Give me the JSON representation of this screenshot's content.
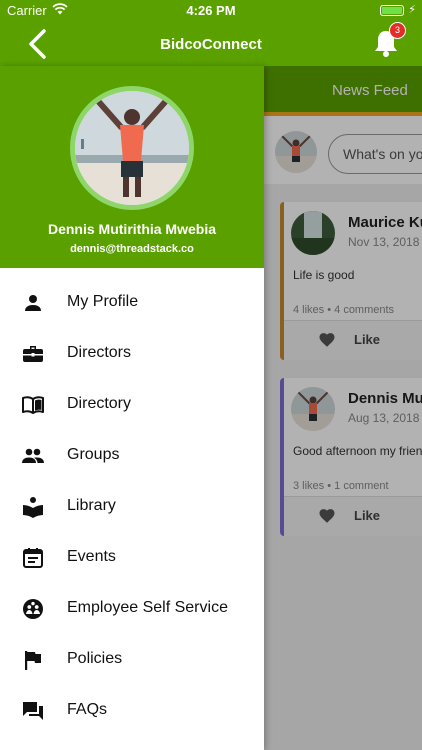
{
  "status_bar": {
    "carrier": "Carrier",
    "time": "4:26 PM",
    "battery_level": 1.0
  },
  "header": {
    "title": "BidcoConnect",
    "notification_count": "3"
  },
  "profile": {
    "name": "Dennis Mutirithia Mwebia",
    "email": "dennis@threadstack.co"
  },
  "menu": {
    "items": [
      {
        "label": "My Profile",
        "icon": "person-icon"
      },
      {
        "label": "Directors",
        "icon": "briefcase-icon"
      },
      {
        "label": "Directory",
        "icon": "book-open-icon"
      },
      {
        "label": "Groups",
        "icon": "people-icon"
      },
      {
        "label": "Library",
        "icon": "reader-icon"
      },
      {
        "label": "Events",
        "icon": "calendar-icon"
      },
      {
        "label": "Employee Self Service",
        "icon": "group-circle-icon"
      },
      {
        "label": "Policies",
        "icon": "flag-icon"
      },
      {
        "label": "FAQs",
        "icon": "chat-bubbles-icon"
      }
    ]
  },
  "feed": {
    "tab_label": "News Feed",
    "composer_placeholder": "What's on yo",
    "posts": [
      {
        "author": "Maurice Ku",
        "date": "Nov 13, 2018 a",
        "text": "Life is good",
        "stats": "4 likes • 4 comments",
        "like_label": "Like",
        "accent": "#c58a2c"
      },
      {
        "author": "Dennis Mut",
        "date": "Aug 13, 2018 a",
        "text": "Good afternoon my frien",
        "stats": "3 likes • 1 comment",
        "like_label": "Like",
        "accent": "#7e6bd3"
      }
    ]
  },
  "colors": {
    "brand_green": "#5aa100",
    "avatar_ring": "#8fd66a",
    "badge_red": "#e52d27",
    "tab_indicator": "#f5a623"
  }
}
